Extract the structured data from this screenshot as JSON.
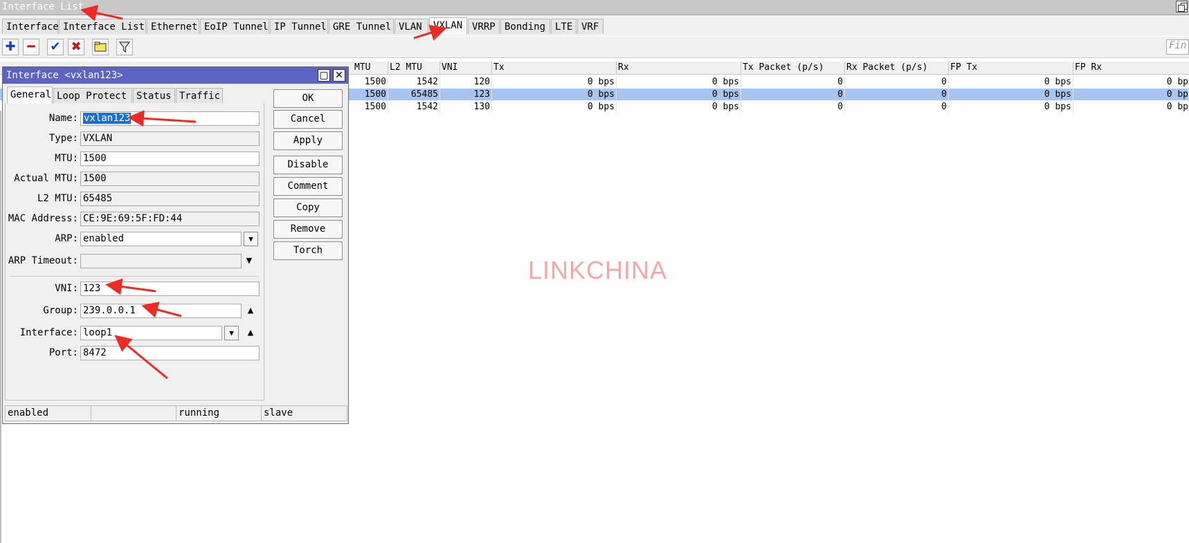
{
  "window": {
    "title": "Interface List"
  },
  "tabs": [
    "Interface",
    "Interface List",
    "Ethernet",
    "EoIP Tunnel",
    "IP Tunnel",
    "GRE Tunnel",
    "VLAN",
    "VXLAN",
    "VRRP",
    "Bonding",
    "LTE",
    "VRF"
  ],
  "active_tab": "VXLAN",
  "toolbar": {
    "icons": [
      "add-icon",
      "remove-icon",
      "enable-icon",
      "disable-icon",
      "comment-icon",
      "filter-icon"
    ],
    "find_placeholder": "Fin"
  },
  "table": {
    "columns": [
      "MTU",
      "L2 MTU",
      "VNI",
      "Tx",
      "Rx",
      "Tx Packet (p/s)",
      "Rx Packet (p/s)",
      "FP Tx",
      "FP Rx"
    ],
    "rows": [
      {
        "mtu": "1500",
        "l2mtu": "1542",
        "vni": "120",
        "tx": "0 bps",
        "rx": "0 bps",
        "txp": "0",
        "rxp": "0",
        "fptx": "0 bps",
        "fprx": "0 bp",
        "selected": false
      },
      {
        "mtu": "1500",
        "l2mtu": "65485",
        "vni": "123",
        "tx": "0 bps",
        "rx": "0 bps",
        "txp": "0",
        "rxp": "0",
        "fptx": "0 bps",
        "fprx": "0 bp",
        "selected": true
      },
      {
        "mtu": "1500",
        "l2mtu": "1542",
        "vni": "130",
        "tx": "0 bps",
        "rx": "0 bps",
        "txp": "0",
        "rxp": "0",
        "fptx": "0 bps",
        "fprx": "0 bp",
        "selected": false
      }
    ]
  },
  "watermark": "LINKCHINA",
  "dialog": {
    "title": "Interface <vxlan123>",
    "tabs": [
      "General",
      "Loop Protect",
      "Status",
      "Traffic"
    ],
    "active_tab": "General",
    "fields": {
      "name": {
        "label": "Name:",
        "value": "vxlan123"
      },
      "type": {
        "label": "Type:",
        "value": "VXLAN"
      },
      "mtu": {
        "label": "MTU:",
        "value": "1500"
      },
      "actual_mtu": {
        "label": "Actual MTU:",
        "value": "1500"
      },
      "l2_mtu": {
        "label": "L2 MTU:",
        "value": "65485"
      },
      "mac": {
        "label": "MAC Address:",
        "value": "CE:9E:69:5F:FD:44"
      },
      "arp": {
        "label": "ARP:",
        "value": "enabled"
      },
      "arp_timeout": {
        "label": "ARP Timeout:",
        "value": ""
      },
      "vni": {
        "label": "VNI:",
        "value": "123"
      },
      "group": {
        "label": "Group:",
        "value": "239.0.0.1"
      },
      "interface": {
        "label": "Interface:",
        "value": "loop1"
      },
      "port": {
        "label": "Port:",
        "value": "8472"
      }
    },
    "buttons": [
      "OK",
      "Cancel",
      "Apply",
      "Disable",
      "Comment",
      "Copy",
      "Remove",
      "Torch"
    ],
    "status": [
      "enabled",
      "",
      "running",
      "slave"
    ]
  },
  "colors": {
    "dialog_title": "#5b63c5",
    "selected_row": "#a8c4f0",
    "annotation_arrow": "#ee2a24",
    "watermark": "#f4a7a7"
  }
}
